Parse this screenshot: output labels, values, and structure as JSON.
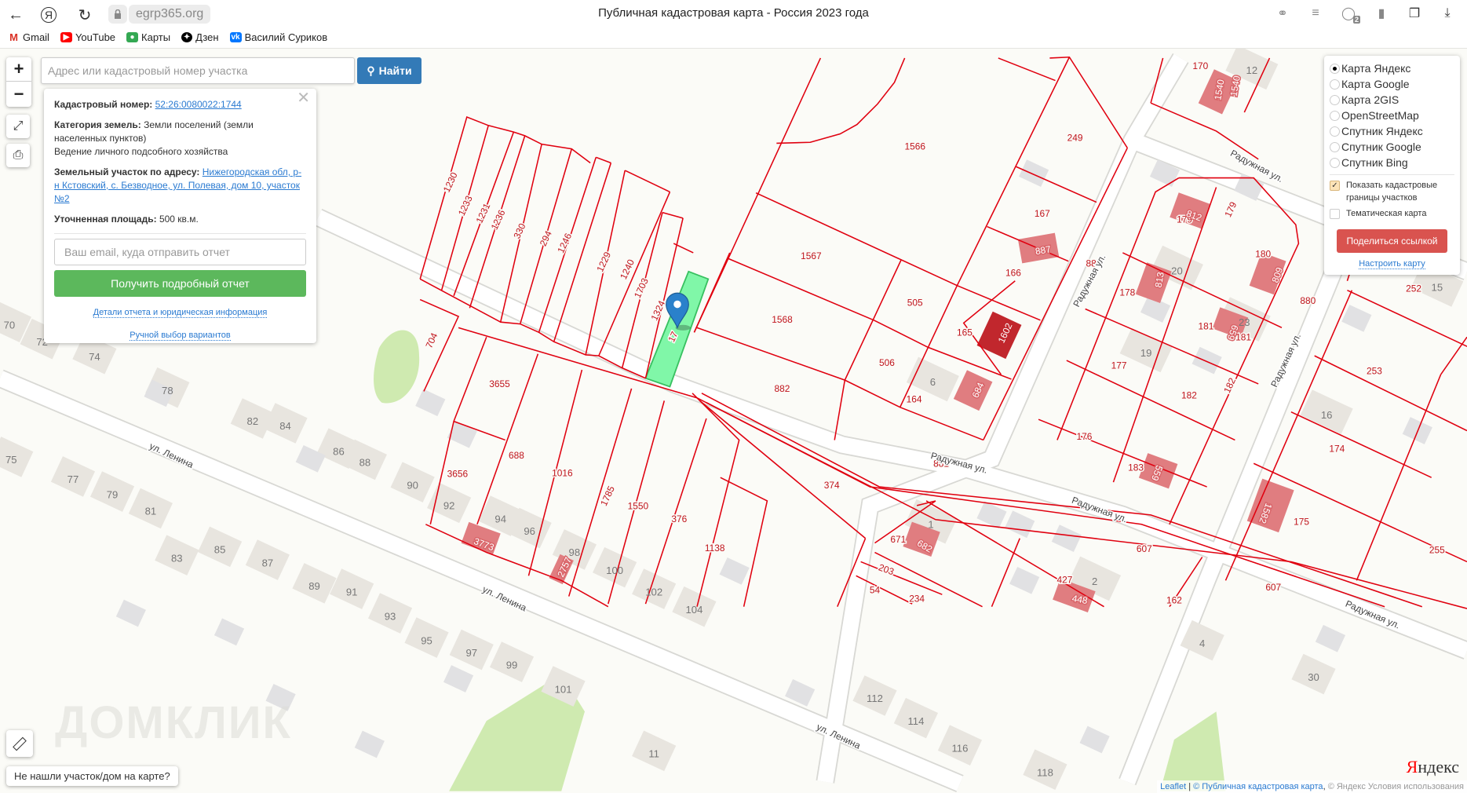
{
  "browser": {
    "url": "egrp365.org",
    "title": "Публичная кадастровая карта - Россия 2023 года",
    "bookmarks": [
      "Gmail",
      "YouTube",
      "Карты",
      "Дзен",
      "Василий Суриков"
    ],
    "extensions_badge": "2"
  },
  "search": {
    "placeholder": "Адрес или кадастровый номер участка",
    "button": "Найти"
  },
  "popup": {
    "cadastral_label": "Кадастровый номер:",
    "cadastral_number": "52:26:0080022:1744",
    "category_label": "Категория земель:",
    "category_value": "Земли поселений (земли населенных пунктов)",
    "usage": "Ведение личного подсобного хозяйства",
    "address_label": "Земельный участок по адресу:",
    "address_value": "Нижегородская обл, р-н Кстовский, с. Безводное, ул. Полевая, дом 10, участок №2",
    "area_label": "Уточненная площадь:",
    "area_value": "500 кв.м.",
    "email_placeholder": "Ваш email, куда отправить отчет",
    "report_button": "Получить подробный отчет",
    "details_link": "Детали отчета и юридическая информация",
    "manual_link": "Ручной выбор вариантов"
  },
  "layers": {
    "options": [
      "Карта Яндекс",
      "Карта Google",
      "Карта 2GIS",
      "OpenStreetMap",
      "Спутник Яндекс",
      "Спутник Google",
      "Спутник Bing"
    ],
    "selected": "Карта Яндекс",
    "show_borders": "Показать кадастровые границы участков",
    "show_borders_checked": true,
    "thematic": "Тематическая карта",
    "thematic_checked": false,
    "share_button": "Поделиться ссылкой",
    "configure_link": "Настроить карту"
  },
  "not_found_button": "Не нашли участок/дом на карте?",
  "watermark": "ДОМКЛИК",
  "yandex_logo": "Яндекс",
  "attribution": {
    "leaflet": "Leaflet",
    "source": "© Публичная кадастровая карта",
    "yandex": "© Яндекс  Условия использования"
  },
  "colors": {
    "parcel_border": "#e0000f",
    "selected_parcel": "#80f7a8",
    "building_pink": "#e07d80",
    "building_dark": "#c1272d",
    "accent_blue": "#337ab7",
    "green_button": "#5cb85c",
    "red_button": "#d9534f"
  },
  "map": {
    "parcel_labels": [
      "1230",
      "1233",
      "1231",
      "1236",
      "330",
      "294",
      "1246",
      "1229",
      "1240",
      "1703",
      "1324",
      "17",
      "704",
      "1566",
      "249",
      "167",
      "166",
      "880",
      "1567",
      "505",
      "1568",
      "165",
      "506",
      "882",
      "164",
      "3655",
      "3656",
      "688",
      "1016",
      "1785",
      "1550",
      "376",
      "1138",
      "374",
      "881",
      "671",
      "203",
      "54",
      "234",
      "607",
      "607",
      "162",
      "427",
      "176",
      "177",
      "178",
      "182",
      "182",
      "181",
      "181",
      "180",
      "179",
      "179",
      "183",
      "174",
      "175",
      "253",
      "252",
      "880",
      "255",
      "170"
    ],
    "building_labels": [
      "1602",
      "887",
      "684",
      "3773",
      "2757",
      "812",
      "813",
      "809",
      "659",
      "559",
      "1582",
      "1540",
      "1540",
      "682",
      "448"
    ],
    "house_numbers": [
      "70",
      "72",
      "74",
      "78",
      "82",
      "84",
      "86",
      "88",
      "75",
      "77",
      "79",
      "81",
      "83",
      "85",
      "87",
      "89",
      "91",
      "93",
      "95",
      "97",
      "99",
      "101",
      "90",
      "92",
      "94",
      "96",
      "98",
      "100",
      "102",
      "104",
      "112",
      "114",
      "116",
      "118",
      "11",
      "4",
      "30",
      "16",
      "19",
      "20",
      "1",
      "2",
      "6",
      "15",
      "12",
      "23"
    ],
    "street_labels": [
      "ул. Ленина",
      "ул. Ленина",
      "ул. Ленина",
      "Радужная ул.",
      "Радужная ул.",
      "Радужная ул.",
      "Радужная ул.",
      "Радужная ул.",
      "Радужная ул."
    ]
  }
}
